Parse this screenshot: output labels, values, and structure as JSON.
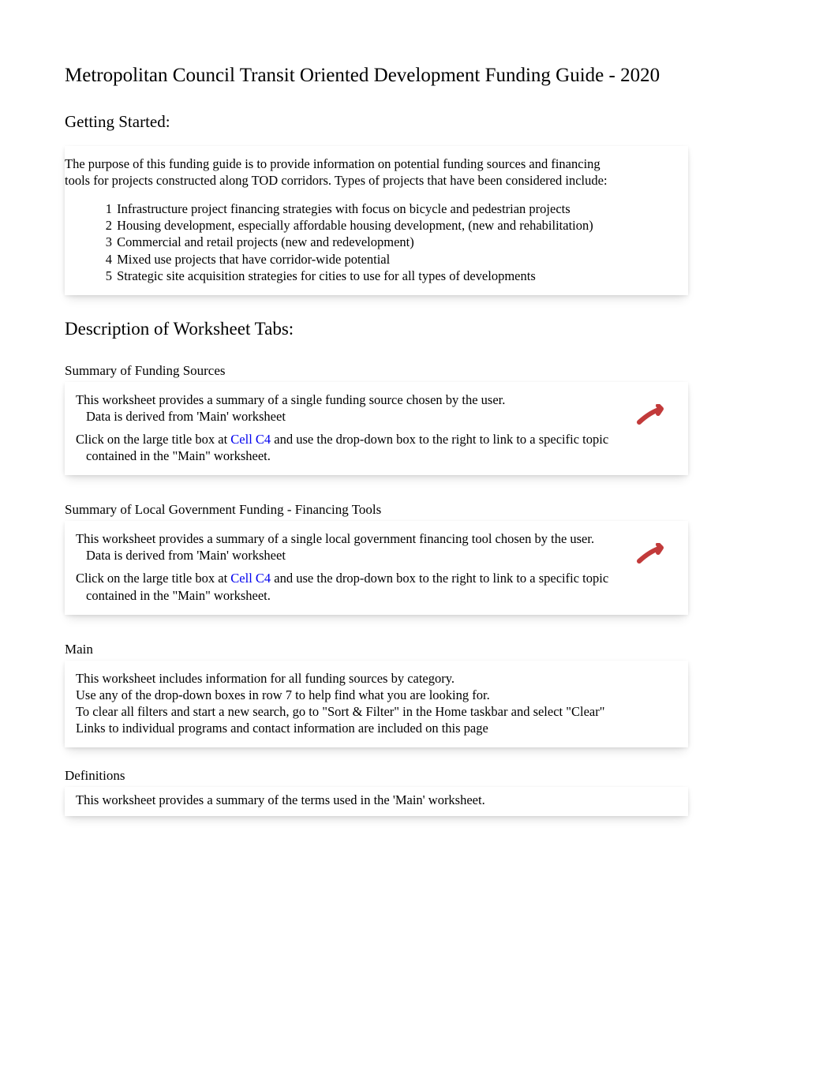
{
  "title": "Metropolitan Council Transit Oriented Development Funding Guide - 2020",
  "gettingStarted": {
    "heading": "Getting Started:",
    "introLine1": "The purpose of this funding guide is to provide information on potential funding sources and financing",
    "introLine2": "tools for projects constructed along TOD corridors. Types of projects that have been considered include:",
    "items": [
      {
        "n": "1",
        "t": "Infrastructure project financing strategies with focus on bicycle and pedestrian projects"
      },
      {
        "n": "2",
        "t": "Housing development, especially affordable housing development, (new and rehabilitation)"
      },
      {
        "n": "3",
        "t": "Commercial and retail projects (new and redevelopment)"
      },
      {
        "n": "4",
        "t": "Mixed use projects that have corridor-wide potential"
      },
      {
        "n": "5",
        "t": "Strategic site acquisition strategies for cities to use for all types of developments"
      }
    ]
  },
  "tabsHeading": "Description of Worksheet Tabs:",
  "summaryFunding": {
    "title": "Summary of Funding Sources",
    "line1": "This worksheet provides a summary of a single funding source chosen by the user.",
    "line2": "Data is derived from 'Main' worksheet",
    "linkPrefix": "Click on the large title box at ",
    "linkCell": "Cell C4",
    "linkSuffix1": " and use the drop-down box to the right to link to a specific topic",
    "linkLine2": "contained in the \"Main\" worksheet."
  },
  "summaryLocal": {
    "title": "Summary of Local Government Funding - Financing Tools",
    "line1": "This worksheet provides a summary of a single local government financing tool chosen by the user.",
    "line2": "Data is derived from 'Main' worksheet",
    "linkPrefix": "Click on the large title box at ",
    "linkCell": "Cell C4",
    "linkSuffix1": " and use the drop-down box to the right to link to a specific topic",
    "linkLine2": "contained in the \"Main\" worksheet."
  },
  "main": {
    "title": "Main",
    "line1": "This worksheet includes information for all funding sources by category.",
    "line2": "Use any of the drop-down boxes in row 7 to help find what you are looking for.",
    "line3": "To clear all filters and start a new search, go to \"Sort & Filter\" in the Home taskbar and select \"Clear\"",
    "line4": "Links to individual programs and contact information are included on this page"
  },
  "defs": {
    "title": "Definitions",
    "line1": "This worksheet provides a summary of the terms used in the 'Main' worksheet."
  }
}
